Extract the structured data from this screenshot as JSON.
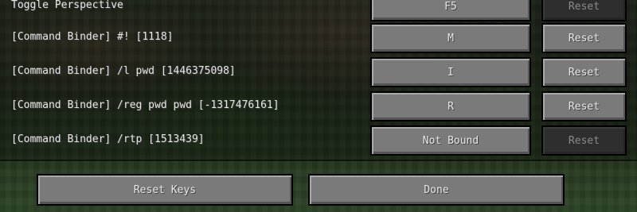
{
  "rows": [
    {
      "label": "Toggle Perspective",
      "key": "F5",
      "reset": "Reset",
      "reset_enabled": false
    },
    {
      "label": "[Command Binder] #! [1118]",
      "key": "M",
      "reset": "Reset",
      "reset_enabled": true
    },
    {
      "label": "[Command Binder] /l pwd [1446375098]",
      "key": "I",
      "reset": "Reset",
      "reset_enabled": true
    },
    {
      "label": "[Command Binder] /reg pwd pwd [-1317476161]",
      "key": "R",
      "reset": "Reset",
      "reset_enabled": true
    },
    {
      "label": "[Command Binder] /rtp [1513439]",
      "key": "Not Bound",
      "reset": "Reset",
      "reset_enabled": false
    }
  ],
  "footer": {
    "reset_keys_label": "Reset Keys",
    "done_label": "Done"
  }
}
